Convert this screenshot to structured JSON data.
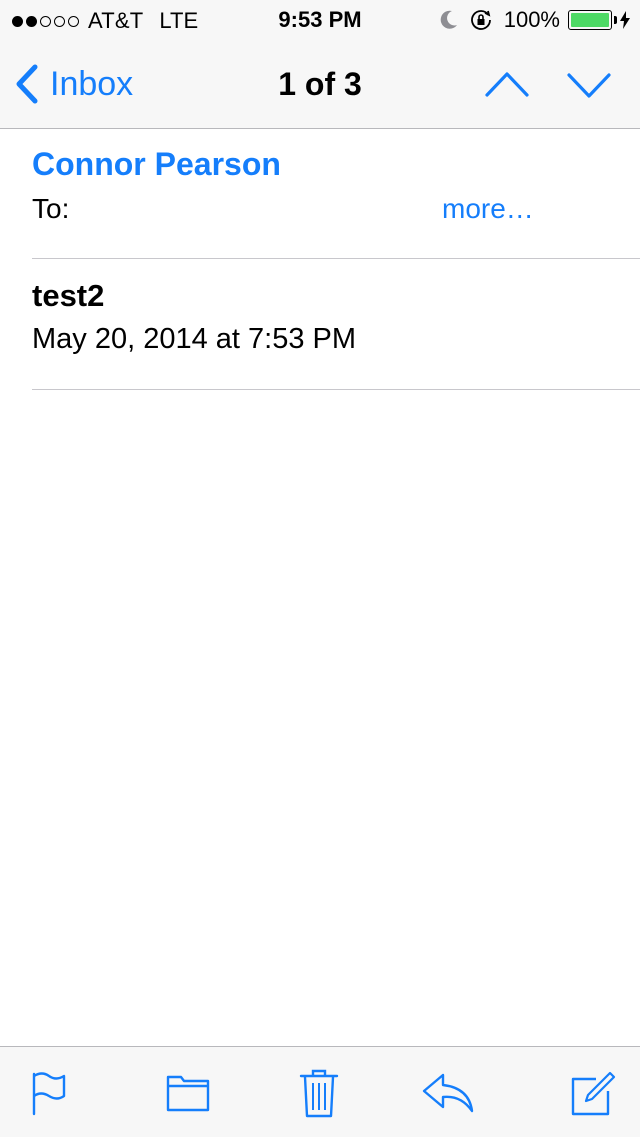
{
  "status_bar": {
    "signal_bars_filled": 2,
    "signal_bars_total": 5,
    "carrier": "AT&T",
    "network": "LTE",
    "time": "9:53 PM",
    "battery_percent": "100%",
    "battery_level": 1.0,
    "icons": [
      "do-not-disturb-moon-icon",
      "rotation-lock-icon",
      "battery-icon",
      "charging-bolt-icon"
    ]
  },
  "nav": {
    "back_label": "Inbox",
    "counter": "1 of 3",
    "icons": [
      "chevron-left-icon",
      "chevron-up-icon",
      "chevron-down-icon"
    ]
  },
  "message": {
    "sender": "Connor Pearson",
    "to_label": "To:",
    "more_label": "more…",
    "subject": "test2",
    "date": "May 20, 2014 at 7:53 PM"
  },
  "toolbar": {
    "icons": [
      "flag-icon",
      "folder-icon",
      "trash-icon",
      "reply-icon",
      "compose-icon"
    ]
  },
  "colors": {
    "accent": "#157efb",
    "bar_background": "#f7f7f7",
    "battery_fill": "#4cd964",
    "separator": "#c8c7cc"
  }
}
